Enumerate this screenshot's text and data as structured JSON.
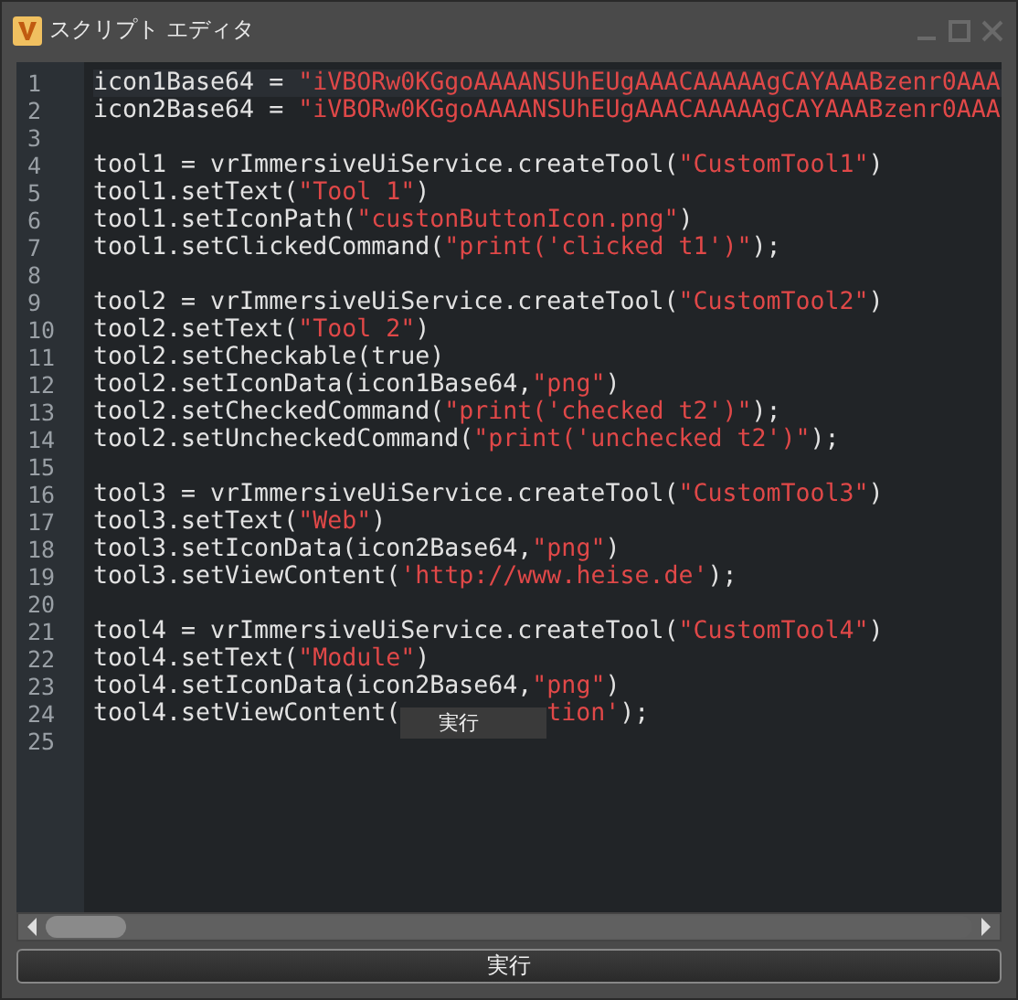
{
  "window": {
    "title": "スクリプト エディタ"
  },
  "editor": {
    "lines": [
      {
        "number": "1",
        "current": true,
        "tokens": [
          {
            "kind": "code",
            "text": "icon1Base64 = "
          },
          {
            "kind": "string",
            "text": "\"iVBORw0KGgoAAAANSUhEUgAAACAAAAAgCAYAAABzenr0AAA"
          }
        ]
      },
      {
        "number": "2",
        "current": false,
        "tokens": [
          {
            "kind": "code",
            "text": "icon2Base64 = "
          },
          {
            "kind": "string",
            "text": "\"iVBORw0KGgoAAAANSUhEUgAAACAAAAAgCAYAAABzenr0AAA"
          }
        ]
      },
      {
        "number": "3",
        "current": false
      },
      {
        "number": "4",
        "current": false,
        "tokens": [
          {
            "kind": "code",
            "text": "tool1 = vrImmersiveUiService.createTool("
          },
          {
            "kind": "string",
            "text": "\"CustomTool1\""
          },
          {
            "kind": "code",
            "text": ")"
          }
        ]
      },
      {
        "number": "5",
        "current": false,
        "tokens": [
          {
            "kind": "code",
            "text": "tool1.setText("
          },
          {
            "kind": "string",
            "text": "\"Tool 1\""
          },
          {
            "kind": "code",
            "text": ")"
          }
        ]
      },
      {
        "number": "6",
        "current": false,
        "tokens": [
          {
            "kind": "code",
            "text": "tool1.setIconPath("
          },
          {
            "kind": "string",
            "text": "\"custonButtonIcon.png\""
          },
          {
            "kind": "code",
            "text": ")"
          }
        ]
      },
      {
        "number": "7",
        "current": false,
        "tokens": [
          {
            "kind": "code",
            "text": "tool1.setClickedCommand("
          },
          {
            "kind": "string",
            "text": "\"print('clicked t1')\""
          },
          {
            "kind": "code",
            "text": ");"
          }
        ]
      },
      {
        "number": "8",
        "current": false
      },
      {
        "number": "9",
        "current": false,
        "tokens": [
          {
            "kind": "code",
            "text": "tool2 = vrImmersiveUiService.createTool("
          },
          {
            "kind": "string",
            "text": "\"CustomTool2\""
          },
          {
            "kind": "code",
            "text": ")"
          }
        ]
      },
      {
        "number": "10",
        "current": false,
        "tokens": [
          {
            "kind": "code",
            "text": "tool2.setText("
          },
          {
            "kind": "string",
            "text": "\"Tool 2\""
          },
          {
            "kind": "code",
            "text": ")"
          }
        ]
      },
      {
        "number": "11",
        "current": false,
        "tokens": [
          {
            "kind": "code",
            "text": "tool2.setCheckable(true)"
          }
        ]
      },
      {
        "number": "12",
        "current": false,
        "tokens": [
          {
            "kind": "code",
            "text": "tool2.setIconData(icon1Base64,"
          },
          {
            "kind": "string",
            "text": "\"png\""
          },
          {
            "kind": "code",
            "text": ")"
          }
        ]
      },
      {
        "number": "13",
        "current": false,
        "tokens": [
          {
            "kind": "code",
            "text": "tool2.setCheckedCommand("
          },
          {
            "kind": "string",
            "text": "\"print('checked t2')\""
          },
          {
            "kind": "code",
            "text": ");"
          }
        ]
      },
      {
        "number": "14",
        "current": false,
        "tokens": [
          {
            "kind": "code",
            "text": "tool2.setUncheckedCommand("
          },
          {
            "kind": "string",
            "text": "\"print('unchecked t2')\""
          },
          {
            "kind": "code",
            "text": ");"
          }
        ]
      },
      {
        "number": "15",
        "current": false
      },
      {
        "number": "16",
        "current": false,
        "tokens": [
          {
            "kind": "code",
            "text": "tool3 = vrImmersiveUiService.createTool("
          },
          {
            "kind": "string",
            "text": "\"CustomTool3\""
          },
          {
            "kind": "code",
            "text": ")"
          }
        ]
      },
      {
        "number": "17",
        "current": false,
        "tokens": [
          {
            "kind": "code",
            "text": "tool3.setText("
          },
          {
            "kind": "string",
            "text": "\"Web\""
          },
          {
            "kind": "code",
            "text": ")"
          }
        ]
      },
      {
        "number": "18",
        "current": false,
        "tokens": [
          {
            "kind": "code",
            "text": "tool3.setIconData(icon2Base64,"
          },
          {
            "kind": "string",
            "text": "\"png\""
          },
          {
            "kind": "code",
            "text": ")"
          }
        ]
      },
      {
        "number": "19",
        "current": false,
        "tokens": [
          {
            "kind": "code",
            "text": "tool3.setViewContent("
          },
          {
            "kind": "string",
            "text": "'http://www.heise.de'"
          },
          {
            "kind": "code",
            "text": ");"
          }
        ]
      },
      {
        "number": "20",
        "current": false
      },
      {
        "number": "21",
        "current": false,
        "tokens": [
          {
            "kind": "code",
            "text": "tool4 = vrImmersiveUiService.createTool("
          },
          {
            "kind": "string",
            "text": "\"CustomTool4\""
          },
          {
            "kind": "code",
            "text": ")"
          }
        ]
      },
      {
        "number": "22",
        "current": false,
        "tokens": [
          {
            "kind": "code",
            "text": "tool4.setText("
          },
          {
            "kind": "string",
            "text": "\"Module\""
          },
          {
            "kind": "code",
            "text": ")"
          }
        ]
      },
      {
        "number": "23",
        "current": false,
        "tokens": [
          {
            "kind": "code",
            "text": "tool4.setIconData(icon2Base64,"
          },
          {
            "kind": "string",
            "text": "\"png\""
          },
          {
            "kind": "code",
            "text": ")"
          }
        ]
      },
      {
        "number": "24",
        "current": false,
        "tokens": [
          {
            "kind": "code",
            "text": "tool4.setViewContent("
          },
          {
            "kind": "tooltip",
            "text": "実行"
          },
          {
            "kind": "string",
            "text": "tion'"
          },
          {
            "kind": "code",
            "text": ");"
          }
        ]
      },
      {
        "number": "25",
        "current": false
      }
    ]
  },
  "run_button": {
    "label": "実行"
  }
}
